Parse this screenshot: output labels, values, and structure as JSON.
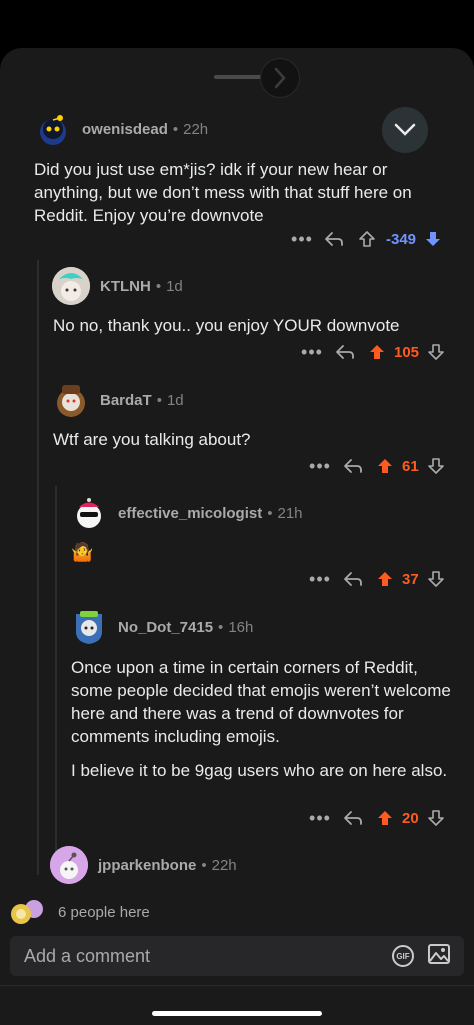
{
  "thread": {
    "collapse_label": "",
    "comments": [
      {
        "username": "owenisdead",
        "time": "22h",
        "text": "Did you just use em*jis? idk if your new hear or anything, but we don’t mess with that stuff here on Reddit. Enjoy you’re downvote",
        "score": "-349",
        "vote": "down"
      },
      {
        "username": "KTLNH",
        "time": "1d",
        "text": "No no, thank you.. you enjoy YOUR downvote",
        "score": "105",
        "vote": "up"
      },
      {
        "username": "BardaT",
        "time": "1d",
        "text": "Wtf are you talking about?",
        "score": "61",
        "vote": "up"
      },
      {
        "username": "effective_micologist",
        "time": "21h",
        "text": "🤷",
        "score": "37",
        "vote": "up"
      },
      {
        "username": "No_Dot_7415",
        "time": "16h",
        "text_p1": "Once upon a time in certain corners of Reddit, some people decided that emojis weren’t welcome here and there was a trend of downvotes for comments including emojis.",
        "text_p2": "I believe it to be 9gag users who are on here also.",
        "score": "20",
        "vote": "up"
      },
      {
        "username": "jpparkenbone",
        "time": "22h"
      }
    ]
  },
  "presence": {
    "text": "6 people here"
  },
  "composer": {
    "placeholder": "Add a comment",
    "gif_label": "GIF"
  },
  "icons": {
    "more": "more-options-icon",
    "reply": "reply-icon",
    "upvote": "upvote-icon",
    "downvote": "downvote-icon",
    "image": "image-icon",
    "collapse": "chevron-down-icon"
  },
  "colors": {
    "upvote": "#ff5a1f",
    "downvote": "#7193ff",
    "background": "#1a1a1b"
  }
}
